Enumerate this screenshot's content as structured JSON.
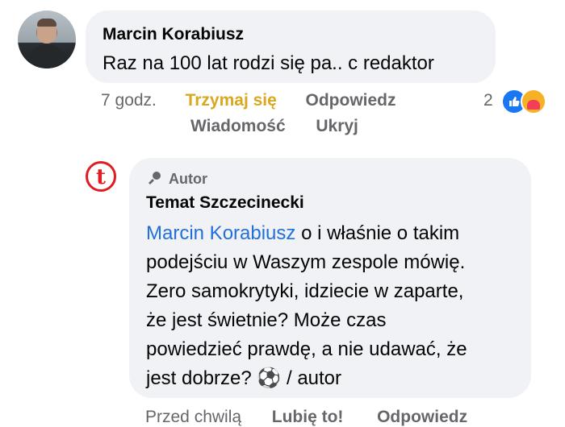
{
  "comment1": {
    "author": "Marcin Korabiusz",
    "text": "Raz na 100 lat rodzi się pa.. c redaktor",
    "time": "7 godz.",
    "reaction_label": "Trzymaj się",
    "reply_label": "Odpowiedz",
    "message_label": "Wiadomość",
    "hide_label": "Ukryj",
    "reaction_count": "2",
    "reaction_icons": [
      "like-icon",
      "care-icon"
    ]
  },
  "comment2": {
    "badge": "Autor",
    "author": "Temat Szczecinecki",
    "logo_letter": "t",
    "mention": "Marcin Korabiusz",
    "text_line1_rest": " o i właśnie o takim",
    "text_line2": "podejściu w Waszym zespole mówię.",
    "text_line3": "Zero samokrytyki, idziecie w zaparte,",
    "text_line4": "że jest świetnie? Może czas",
    "text_line5": "powiedzieć prawdę, a nie udawać, że",
    "text_line6_start": "jest dobrze? ",
    "emoji": "⚽",
    "text_line6_end": " / autor",
    "time": "Przed chwilą",
    "like_label": "Lubię to!",
    "reply_label": "Odpowiedz"
  },
  "colors": {
    "mention": "#216fdb",
    "reaction_highlight": "#d9a81f",
    "bubble": "#f0f2f5",
    "brand_red": "#e01b22"
  }
}
